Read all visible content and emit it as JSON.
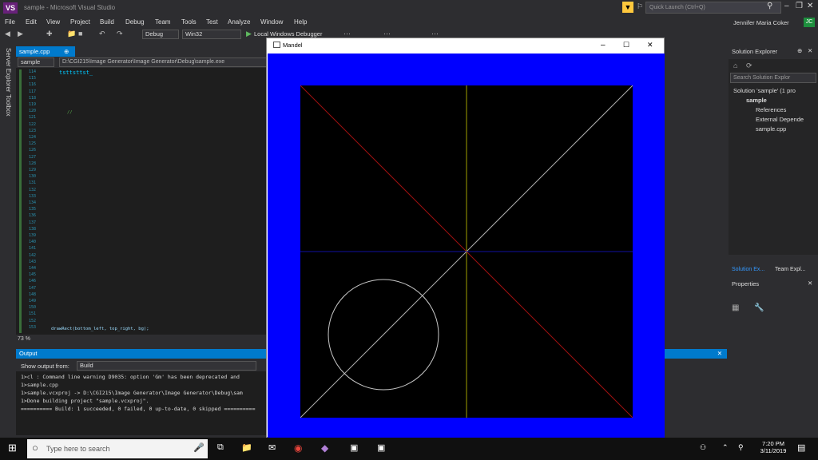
{
  "app": {
    "logo": "VS",
    "title": "sample - Microsoft Visual Studio"
  },
  "quick_launch": {
    "placeholder": "Quick Launch (Ctrl+Q)"
  },
  "menu": [
    "File",
    "Edit",
    "View",
    "Project",
    "Build",
    "Debug",
    "Team",
    "Tools",
    "Test",
    "Analyze",
    "Window",
    "Help"
  ],
  "account": {
    "name": "Jennifer Maria Coker",
    "initials": "JC"
  },
  "toolbar": {
    "config": "Debug",
    "platform": "Win32",
    "debugger": "Local Windows Debugger"
  },
  "side_strip": {
    "server_explorer": "Server Explorer",
    "toolbox": "Toolbox"
  },
  "editor": {
    "tab": "sample.cpp",
    "scope_combo": "sample",
    "path_combo": "D:\\CGI215\\Image Generator\\Image Generator\\Debug\\sample.exe",
    "console_text": "tsttsttst_",
    "line_numbers": [
      "114",
      "115",
      "116",
      "117",
      "118",
      "119",
      "120",
      "121",
      "122",
      "123",
      "124",
      "125",
      "126",
      "127",
      "128",
      "129",
      "130",
      "131",
      "132",
      "133",
      "134",
      "135",
      "136",
      "137",
      "138",
      "139",
      "140",
      "141",
      "142",
      "143",
      "144",
      "145",
      "146",
      "147",
      "148",
      "149",
      "150",
      "151",
      "152",
      "153"
    ],
    "comment_line": "//",
    "code_last": "drawRect(bottom_left, top_right, bg);",
    "zoom": "73 %"
  },
  "solution_explorer": {
    "title": "Solution Explorer",
    "search_placeholder": "Search Solution Explor",
    "solution": "Solution 'sample' (1 pro",
    "project": "sample",
    "items": [
      "References",
      "External Depende",
      "sample.cpp"
    ],
    "tabs": [
      "Solution Ex...",
      "Team Expl..."
    ]
  },
  "properties": {
    "title": "Properties"
  },
  "output": {
    "title": "Output",
    "show_from_label": "Show output from:",
    "show_from_value": "Build",
    "lines": [
      "1>cl : Command line warning D9035: option 'Gm' has been deprecated and",
      "1>sample.cpp",
      "1>sample.vcxproj -> D:\\CGI215\\Image Generator\\Image Generator\\Debug\\sam",
      "1>Done building project \"sample.vcxproj\".",
      "========== Build: 1 succeeded, 0 failed, 0 up-to-date, 0 skipped =========="
    ]
  },
  "mandel": {
    "title": "Mandel",
    "background_color": "#0000ff",
    "plot_color": "#000000",
    "circle_color": "#c8c8c8",
    "diag1_color": "#a01010",
    "diag2_color": "#b0b0b0",
    "vline_color": "#a0a000",
    "hline_color": "#1010a0"
  },
  "taskbar": {
    "search_placeholder": "Type here to search",
    "time": "7:20 PM",
    "date": "3/11/2019"
  },
  "colors": {
    "accent": "#007acc",
    "vs_bg": "#2d2d30",
    "editor_bg": "#1e1e1e"
  }
}
